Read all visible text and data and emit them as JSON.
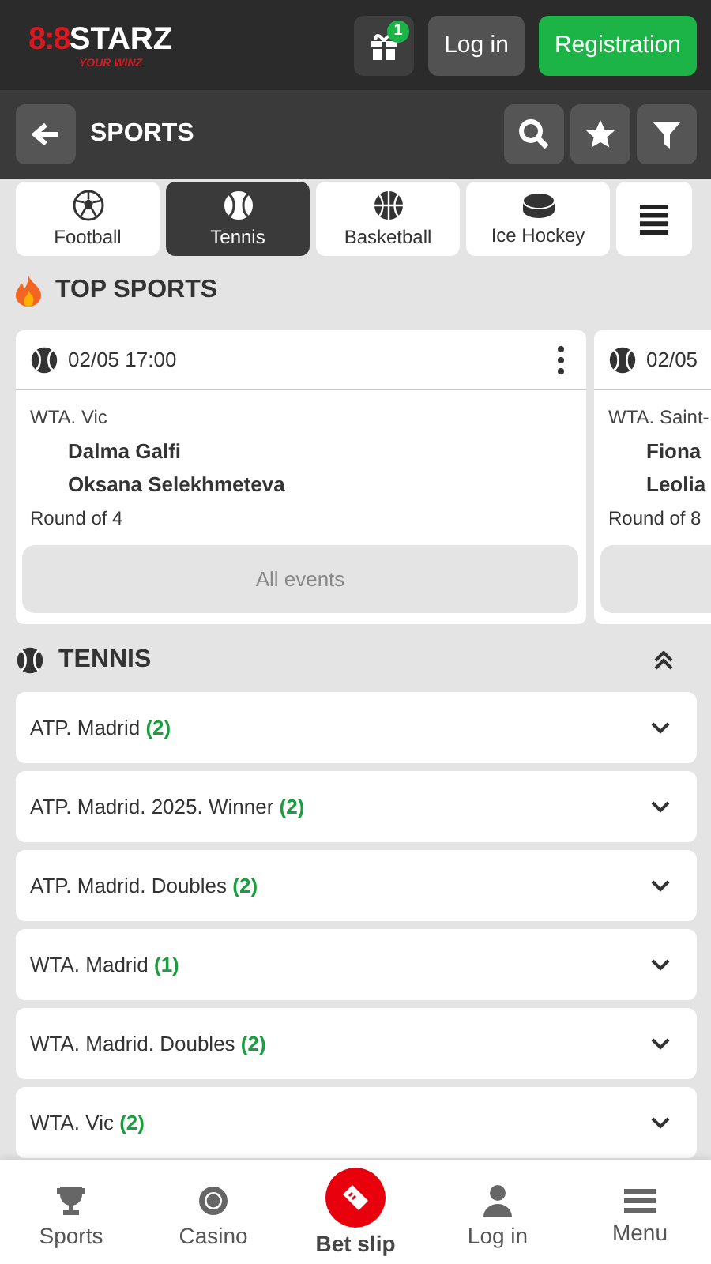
{
  "header": {
    "logo": {
      "mark": "8:8",
      "name": "STARZ",
      "tagline": "YOUR WINZ"
    },
    "gift_badge": "1",
    "login": "Log in",
    "register": "Registration"
  },
  "subheader": {
    "title": "SPORTS"
  },
  "sport_tabs": [
    {
      "label": "Football",
      "selected": false
    },
    {
      "label": "Tennis",
      "selected": true
    },
    {
      "label": "Basketball",
      "selected": false
    },
    {
      "label": "Ice Hockey",
      "selected": false
    }
  ],
  "top_sports": {
    "title": "TOP SPORTS",
    "events": [
      {
        "datetime": "02/05 17:00",
        "tournament": "WTA. Vic",
        "players": [
          "Dalma Galfi",
          "Oksana Selekhmeteva"
        ],
        "round": "Round of 4",
        "button": "All events"
      },
      {
        "datetime": "02/05",
        "tournament": "WTA. Saint-",
        "players": [
          "Fiona",
          "Leolia"
        ],
        "round": "Round of 8"
      }
    ]
  },
  "tennis": {
    "title": "TENNIS",
    "expanded": true,
    "tournaments": [
      {
        "name": "ATP. Madrid",
        "count": "(2)"
      },
      {
        "name": "ATP. Madrid. 2025. Winner",
        "count": "(2)"
      },
      {
        "name": "ATP. Madrid. Doubles",
        "count": "(2)"
      },
      {
        "name": "WTA. Madrid",
        "count": "(1)"
      },
      {
        "name": "WTA. Madrid. Doubles",
        "count": "(2)"
      },
      {
        "name": "WTA. Vic",
        "count": "(2)"
      }
    ]
  },
  "bottom_nav": [
    {
      "label": "Sports",
      "kind": "plain"
    },
    {
      "label": "Casino",
      "kind": "plain"
    },
    {
      "label": "Bet slip",
      "kind": "featured"
    },
    {
      "label": "Log in",
      "kind": "plain"
    },
    {
      "label": "Menu",
      "kind": "plain"
    }
  ]
}
